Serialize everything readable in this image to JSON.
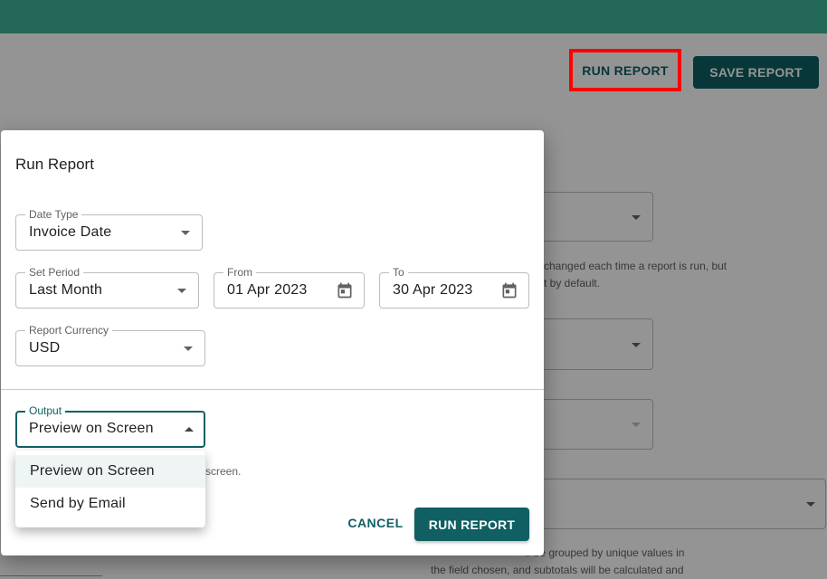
{
  "background": {
    "run_report_label": "RUN REPORT",
    "save_report_label": "SAVE REPORT",
    "help_text_1_line1": "changed each time a report is run, but",
    "help_text_1_line2": "t by default.",
    "help_text_2_line1": "ll be grouped by unique values in",
    "help_text_2_line2": "the field chosen, and subtotals will be calculated and"
  },
  "dialog": {
    "title": "Run Report",
    "date_type": {
      "label": "Date Type",
      "value": "Invoice Date"
    },
    "set_period": {
      "label": "Set Period",
      "value": "Last Month"
    },
    "from": {
      "label": "From",
      "value": "01 Apr 2023"
    },
    "to": {
      "label": "To",
      "value": "30 Apr 2023"
    },
    "report_currency": {
      "label": "Report Currency",
      "value": "USD"
    },
    "output": {
      "label": "Output",
      "value": "Preview on Screen"
    },
    "output_helper": "n screen.",
    "cancel_label": "CANCEL",
    "run_label": "RUN REPORT"
  },
  "output_menu": {
    "options": [
      "Preview on Screen",
      "Send by Email"
    ],
    "selected_index": 0
  },
  "colors": {
    "primary": "#0f5f63",
    "topbar": "#3fb39a",
    "highlight": "#ff0000"
  }
}
